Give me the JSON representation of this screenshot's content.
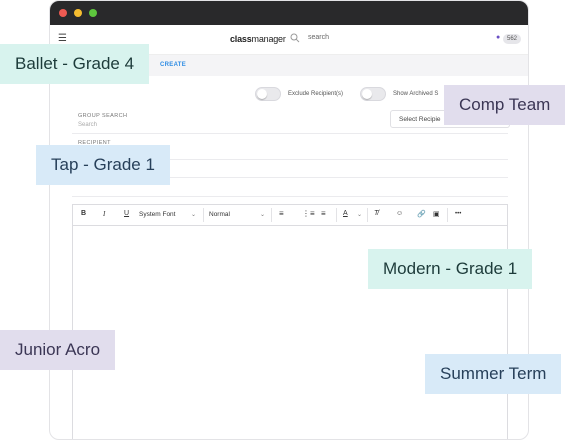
{
  "app": {
    "brand_bold": "class",
    "brand_rest": "manager",
    "search_placeholder": "search",
    "notification_count": "562",
    "menu_icon": "hamburger-icon",
    "bell_icon": "bell-icon"
  },
  "subnav": {
    "link": "CREATE"
  },
  "toggles": [
    {
      "label": "Exclude Recipient(s)",
      "checked": false
    },
    {
      "label": "Show Archived S",
      "checked": false
    }
  ],
  "form": {
    "group_search_label": "GROUP SEARCH",
    "group_search_placeholder": "Search",
    "select_button": "Select Recipie",
    "recipient_label": "RECIPIENT"
  },
  "toolbar": {
    "bold": "B",
    "italic": "I",
    "underline": "U",
    "font": "System Font",
    "size": "Normal",
    "more": "•••"
  },
  "tags": {
    "ballet": "Ballet - Grade 4",
    "comp": "Comp Team",
    "tap": "Tap - Grade 1",
    "modern": "Modern - Grade 1",
    "acro": "Junior Acro",
    "summer": "Summer Term"
  },
  "colors": {
    "accent": "#2f8de4",
    "titlebar": "#29292b",
    "tag_green": "#d8f3ee",
    "tag_blue": "#d8eaf8",
    "tag_lavender": "#e1dded"
  }
}
